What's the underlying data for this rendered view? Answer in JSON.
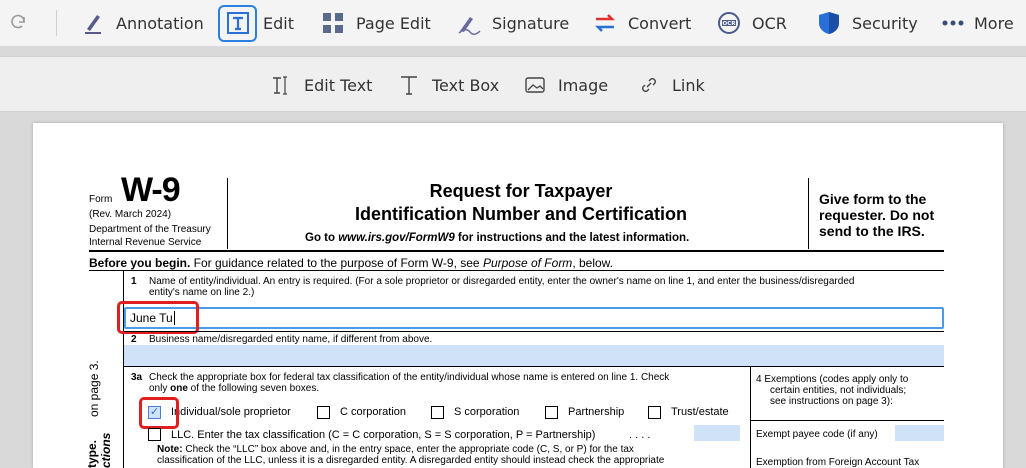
{
  "toolbar": {
    "items": [
      {
        "label": "Annotation",
        "icon": "pen-icon"
      },
      {
        "label": "Edit",
        "icon": "edit-text-icon",
        "active": true
      },
      {
        "label": "Page Edit",
        "icon": "page-grid-icon"
      },
      {
        "label": "Signature",
        "icon": "signature-icon"
      },
      {
        "label": "Convert",
        "icon": "convert-icon"
      },
      {
        "label": "OCR",
        "icon": "ocr-icon"
      },
      {
        "label": "Security",
        "icon": "shield-icon"
      },
      {
        "label": "More",
        "icon": "more-dots-icon"
      }
    ],
    "accent": "#2a7fe0"
  },
  "subbar": {
    "items": [
      {
        "label": "Edit Text",
        "icon": "edit-text-cursor-icon"
      },
      {
        "label": "Text Box",
        "icon": "text-box-icon"
      },
      {
        "label": "Image",
        "icon": "image-icon"
      },
      {
        "label": "Link",
        "icon": "link-icon"
      }
    ]
  },
  "form": {
    "form_word": "Form",
    "number": "W-9",
    "rev": "(Rev. March 2024)",
    "dept": "Department of the Treasury",
    "irs": "Internal Revenue Service",
    "title1": "Request for Taxpayer",
    "title2": "Identification Number and Certification",
    "goto_pre": "Go to ",
    "goto_url": "www.irs.gov/FormW9",
    "goto_post": " for instructions and the latest information.",
    "give1": "Give form to the",
    "give2": "requester. Do not",
    "give3": "send to the IRS.",
    "before_bold": "Before you begin.",
    "before_text": " For guidance related to the purpose of Form W-9, see ",
    "before_italic": "Purpose of Form",
    "before_end": ", below.",
    "line1_num": "1",
    "line1_text_a": "Name of entity/individual. An entry is required. (For a sole proprietor or disregarded entity, enter the owner's name on line 1, and enter the business/disregarded",
    "line1_text_b": "entity's name on line 2.)",
    "name_value": "June Tu",
    "line2_num": "2",
    "line2_text": "Business name/disregarded entity name, if different from above.",
    "line3a_num": "3a",
    "line3a_text_a": "Check the appropriate box for federal tax classification of the entity/individual whose name is entered on line 1. Check",
    "line3a_only": "only ",
    "line3a_one": "one",
    "line3a_text_b": " of the following seven boxes.",
    "checkboxes": [
      {
        "label": "Individual/sole proprietor",
        "checked": true
      },
      {
        "label": "C corporation",
        "checked": false
      },
      {
        "label": "S corporation",
        "checked": false
      },
      {
        "label": "Partnership",
        "checked": false
      },
      {
        "label": "Trust/estate",
        "checked": false
      }
    ],
    "llc_text": "LLC. Enter the tax classification (C = C corporation, S = S corporation, P = Partnership)",
    "llc_dots": ".   .   .   .",
    "note_bold": "Note:",
    "note_text_a": " Check the “LLC” box above and, in the entry space, enter the appropriate code (C, S, or P) for the tax",
    "note_text_b": "classification of the LLC, unless it is a disregarded entity. A disregarded entity should instead check the appropriate",
    "exempt_text_a": "4  Exemptions (codes apply only to",
    "exempt_text_b": "certain entities, not individuals;",
    "exempt_text_c": "see instructions on page 3):",
    "exempt_payee": "Exempt payee code (if any)",
    "exempt_fatca": "Exemption from Foreign Account Tax",
    "side_text_a": "on page 3.",
    "side_text_b": "type.",
    "side_text_c": "ctions"
  }
}
